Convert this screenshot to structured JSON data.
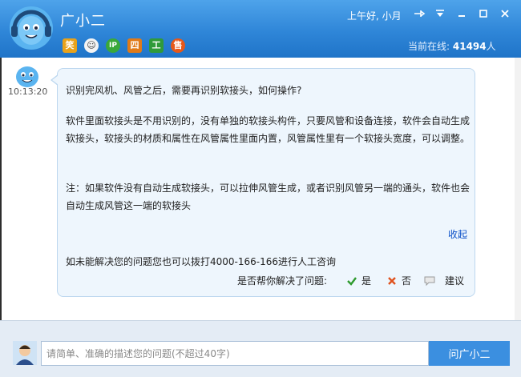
{
  "header": {
    "title": "广小二",
    "greeting": "上午好, 小月",
    "online_label": "当前在线:",
    "online_count": "41494",
    "online_unit": "人",
    "tools": [
      {
        "icon": "laugh-icon",
        "glyph": "笑",
        "color": "#e8a21a"
      },
      {
        "icon": "smiley-icon",
        "glyph": "☺",
        "color": "#f4f4f4"
      },
      {
        "icon": "ip-icon",
        "glyph": "IP",
        "color": "#3aa83a"
      },
      {
        "icon": "grid-icon",
        "glyph": "四",
        "color": "#e07a18"
      },
      {
        "icon": "work-icon",
        "glyph": "工",
        "color": "#2f9a3a"
      },
      {
        "icon": "sale-icon",
        "glyph": "售",
        "color": "#e6581a"
      }
    ]
  },
  "message": {
    "time": "10:13:20",
    "question": "识别完风机、风管之后，需要再识别软接头，如何操作?",
    "paragraph1": "软件里面软接头是不用识别的，没有单独的软接头构件，只要风管和设备连接，软件会自动生成软接头，软接头的材质和属性在风管属性里面内置，风管属性里有一个软接头宽度，可以调整。",
    "paragraph2": "注：如果软件没有自动生成软接头，可以拉伸风管生成，或者识别风管另一端的通头，软件也会自动生成风管这一端的软接头",
    "collapse_label": "收起",
    "contact_text": "如未能解决您的问题您也可以拨打4000-166-166进行人工咨询",
    "feedback_question": "是否帮你解决了问题:",
    "yes_label": "是",
    "no_label": "否",
    "suggest_label": "建议"
  },
  "input": {
    "placeholder": "请简单、准确的描述您的问题(不超过40字)",
    "ask_button": "问广小二"
  },
  "colors": {
    "header_blue": "#2f86d8",
    "bubble_bg": "#eef6fd",
    "link_blue": "#0b50c8",
    "button_blue": "#3b8fe0"
  }
}
